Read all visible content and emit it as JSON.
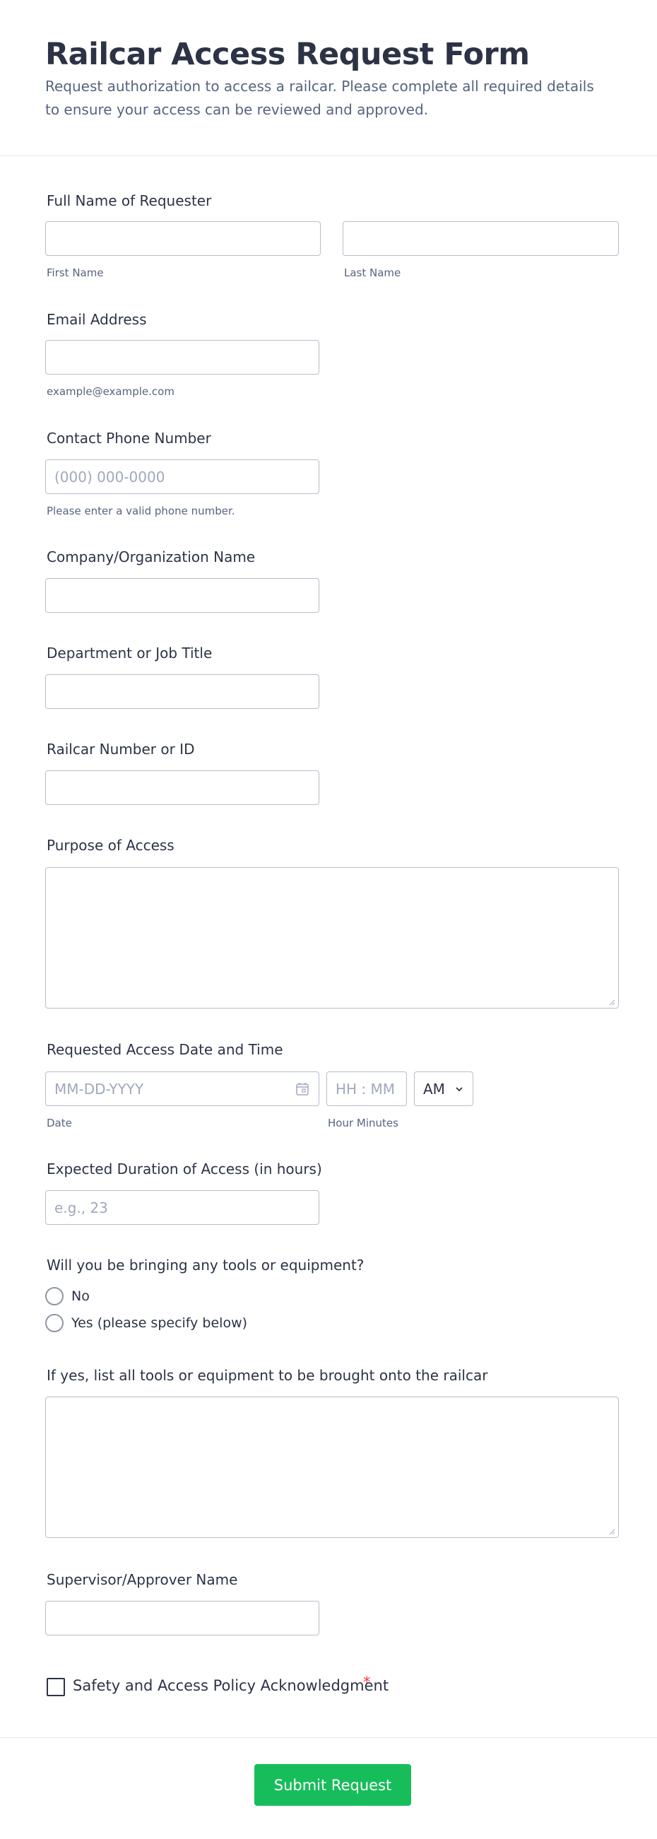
{
  "header": {
    "title": "Railcar Access Request Form",
    "subtitle": "Request authorization to access a railcar. Please complete all required details to ensure your access can be reviewed and approved."
  },
  "fields": {
    "full_name": {
      "label": "Full Name of Requester",
      "first_sublabel": "First Name",
      "last_sublabel": "Last Name",
      "first_value": "",
      "last_value": ""
    },
    "email": {
      "label": "Email Address",
      "sublabel": "example@example.com",
      "value": ""
    },
    "phone": {
      "label": "Contact Phone Number",
      "placeholder": "(000) 000-0000",
      "sublabel": "Please enter a valid phone number.",
      "value": ""
    },
    "company": {
      "label": "Company/Organization Name",
      "value": ""
    },
    "department": {
      "label": "Department or Job Title",
      "value": ""
    },
    "railcar": {
      "label": "Railcar Number or ID",
      "value": ""
    },
    "purpose": {
      "label": "Purpose of Access",
      "value": ""
    },
    "datetime": {
      "label": "Requested Access Date and Time",
      "date_placeholder": "MM-DD-YYYY",
      "time_placeholder": "HH : MM",
      "ampm_value": "AM",
      "date_sublabel": "Date",
      "time_sublabel": "Hour Minutes"
    },
    "duration": {
      "label": "Expected Duration of Access (in hours)",
      "placeholder": "e.g., 23",
      "value": ""
    },
    "tools_question": {
      "label": "Will you be bringing any tools or equipment?",
      "options": [
        "No",
        "Yes (please specify below)"
      ]
    },
    "tools_list": {
      "label": "If yes, list all tools or equipment to be brought onto the railcar",
      "value": ""
    },
    "supervisor": {
      "label": "Supervisor/Approver Name",
      "value": ""
    },
    "acknowledgment": {
      "label": "Safety and Access Policy Acknowledgment",
      "required_mark": "*"
    }
  },
  "footer": {
    "submit_label": "Submit Request"
  },
  "colors": {
    "accent": "#18bd5b",
    "required": "#f23a3c",
    "text": "#2c3345",
    "muted": "#57647e",
    "border": "#b8bdc9"
  },
  "icons": {
    "date": "calendar-icon",
    "ampm": "chevron-down-icon",
    "textarea": "resize-grip-icon"
  }
}
